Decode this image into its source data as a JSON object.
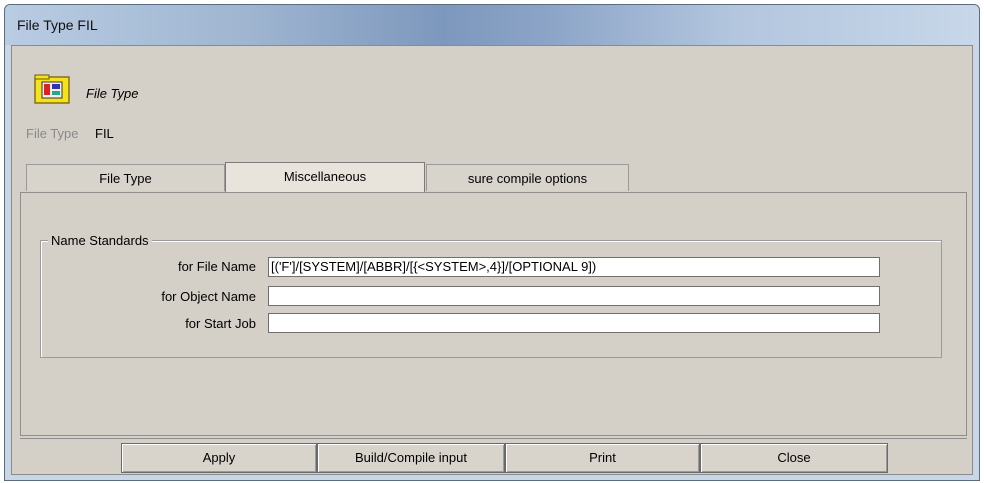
{
  "window": {
    "title": "File Type FIL"
  },
  "header": {
    "caption": "File Type",
    "key_label": "File Type",
    "key_value": "FIL",
    "icon": "file-type-icon"
  },
  "tabs": [
    {
      "label": "File Type",
      "active": false
    },
    {
      "label": "Miscellaneous",
      "active": true
    },
    {
      "label": "sure compile options",
      "active": false
    }
  ],
  "group": {
    "title": "Name Standards",
    "fields": [
      {
        "label": "for File Name",
        "value": "[('F']/[SYSTEM]/[ABBR]/[{<SYSTEM>,4}]/[OPTIONAL 9])"
      },
      {
        "label": "for Object Name",
        "value": ""
      },
      {
        "label": "for Start Job",
        "value": ""
      }
    ]
  },
  "buttons": {
    "apply": "Apply",
    "build": "Build/Compile input",
    "print": "Print",
    "close": "Close"
  }
}
